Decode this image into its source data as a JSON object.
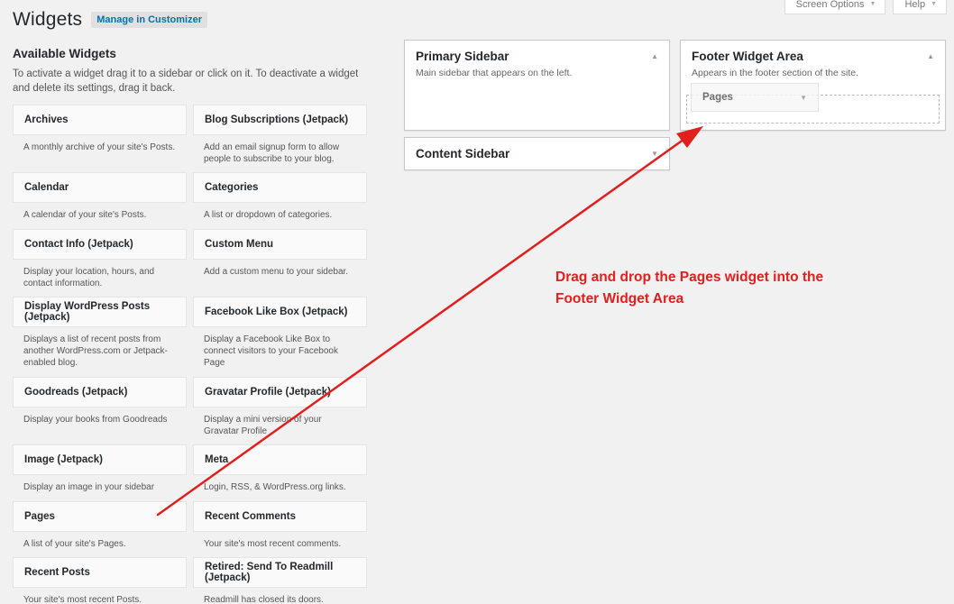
{
  "header": {
    "title": "Widgets",
    "manage_label": "Manage in Customizer",
    "screen_options_label": "Screen Options",
    "help_label": "Help"
  },
  "available": {
    "title": "Available Widgets",
    "description": "To activate a widget drag it to a sidebar or click on it. To deactivate a widget and delete its settings, drag it back."
  },
  "widgets_col1": [
    {
      "name": "Archives",
      "desc": "A monthly archive of your site's Posts."
    },
    {
      "name": "Calendar",
      "desc": "A calendar of your site's Posts."
    },
    {
      "name": "Contact Info (Jetpack)",
      "desc": "Display your location, hours, and contact information."
    },
    {
      "name": "Display WordPress Posts (Jetpack)",
      "desc": "Displays a list of recent posts from another WordPress.com or Jetpack-enabled blog."
    },
    {
      "name": "Goodreads (Jetpack)",
      "desc": "Display your books from Goodreads"
    },
    {
      "name": "Image (Jetpack)",
      "desc": "Display an image in your sidebar"
    },
    {
      "name": "Pages",
      "desc": "A list of your site's Pages."
    },
    {
      "name": "Recent Posts",
      "desc": "Your site's most recent Posts."
    }
  ],
  "widgets_col2": [
    {
      "name": "Blog Subscriptions (Jetpack)",
      "desc": "Add an email signup form to allow people to subscribe to your blog."
    },
    {
      "name": "Categories",
      "desc": "A list or dropdown of categories."
    },
    {
      "name": "Custom Menu",
      "desc": "Add a custom menu to your sidebar."
    },
    {
      "name": "Facebook Like Box (Jetpack)",
      "desc": "Display a Facebook Like Box to connect visitors to your Facebook Page"
    },
    {
      "name": "Gravatar Profile (Jetpack)",
      "desc": "Display a mini version of your Gravatar Profile"
    },
    {
      "name": "Meta",
      "desc": "Login, RSS, & WordPress.org links."
    },
    {
      "name": "Recent Comments",
      "desc": "Your site's most recent comments."
    },
    {
      "name": "Retired: Send To Readmill (Jetpack)",
      "desc": "Readmill has closed its doors."
    }
  ],
  "sidebars": {
    "primary": {
      "title": "Primary Sidebar",
      "desc": "Main sidebar that appears on the left."
    },
    "content": {
      "title": "Content Sidebar"
    },
    "footer": {
      "title": "Footer Widget Area",
      "desc": "Appears in the footer section of the site."
    }
  },
  "dragging_widget": {
    "name": "Pages"
  },
  "annotation": {
    "line1": "Drag and drop the Pages widget into the",
    "line2": "Footer Widget Area",
    "color": "#e0201e"
  },
  "icons": {
    "caret_up": "▲",
    "caret_down": "▼"
  }
}
